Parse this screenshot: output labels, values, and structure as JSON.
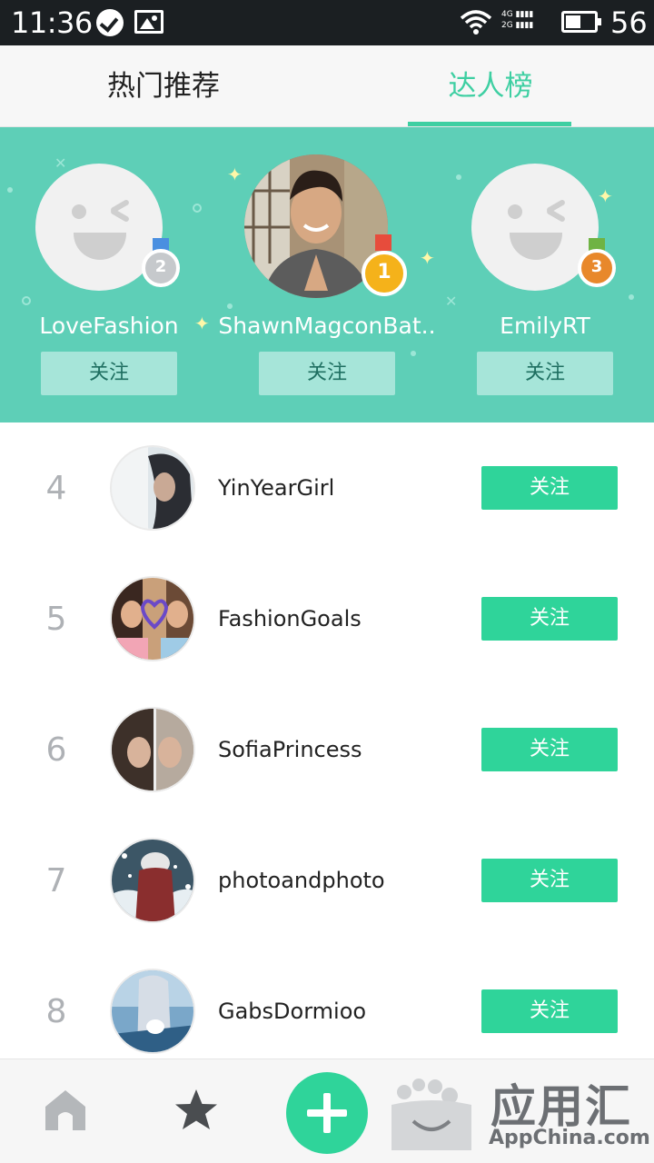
{
  "status_bar": {
    "time": "11:36",
    "network_4g": "4G",
    "network_2g": "2G",
    "battery_level": "56"
  },
  "tabs": [
    {
      "label": "热门推荐",
      "active": false
    },
    {
      "label": "达人榜",
      "active": true
    }
  ],
  "top_three": [
    {
      "rank": "2",
      "name": "LoveFashion",
      "follow": "关注",
      "avatar": "placeholder-face-icon",
      "medal_color": "#c6c9cc"
    },
    {
      "rank": "1",
      "name": "ShawnMagconBat..",
      "follow": "关注",
      "avatar": "photo",
      "medal_color": "#f5b21a"
    },
    {
      "rank": "3",
      "name": "EmilyRT",
      "follow": "关注",
      "avatar": "placeholder-face-icon",
      "medal_color": "#e8882b"
    }
  ],
  "ranking": [
    {
      "rank": "4",
      "name": "YinYearGirl",
      "follow": "关注"
    },
    {
      "rank": "5",
      "name": "FashionGoals",
      "follow": "关注"
    },
    {
      "rank": "6",
      "name": "SofiaPrincess",
      "follow": "关注"
    },
    {
      "rank": "7",
      "name": "photoandphoto",
      "follow": "关注"
    },
    {
      "rank": "8",
      "name": "GabsDormioo",
      "follow": "关注"
    }
  ],
  "bottom_nav": {
    "items": [
      "home-icon",
      "star-icon",
      "add-icon",
      "profile-icon"
    ]
  },
  "watermark": {
    "main": "应用汇",
    "sub": "AppChina.com"
  },
  "colors": {
    "accent": "#3ecfa2",
    "follow_button": "#2fd49a",
    "podium_bg": "#5ecfb7"
  }
}
